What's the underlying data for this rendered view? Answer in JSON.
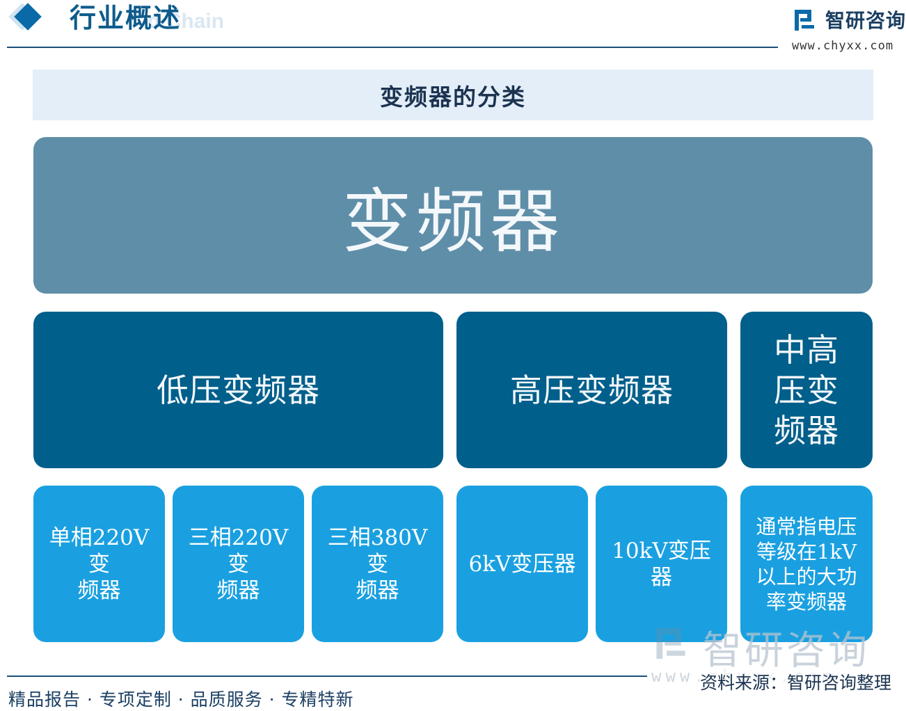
{
  "header": {
    "section_title": "行业概述",
    "ghost_text": "d Chain",
    "logo_name": "智研咨询",
    "logo_url": "www.chyxx.com"
  },
  "title": "变频器的分类",
  "root": {
    "label": "变频器"
  },
  "categories": [
    {
      "label": "低压变频器"
    },
    {
      "label": "高压变频器"
    },
    {
      "label": "中高\n压变\n频器"
    }
  ],
  "leaves": [
    {
      "label": "单相220V变\n频器"
    },
    {
      "label": "三相220V变\n频器"
    },
    {
      "label": "三相380V变\n频器"
    },
    {
      "label": "6kV变压器"
    },
    {
      "label": "10kV变压器"
    },
    {
      "label": "通常指电压\n等级在1kV\n以上的大功\n率变频器"
    }
  ],
  "watermark": {
    "text": "智研咨询",
    "url": "www.chyxx.com"
  },
  "footer": {
    "left": "精品报告 · 专项定制 · 品质服务 · 专精特新",
    "source": "资料来源：智研咨询整理"
  },
  "colors": {
    "root": "#5f8ea8",
    "category": "#005f8b",
    "leaf": "#1aa0e0",
    "title_bar": "#e3eef8",
    "accent": "#0e5b8c"
  }
}
